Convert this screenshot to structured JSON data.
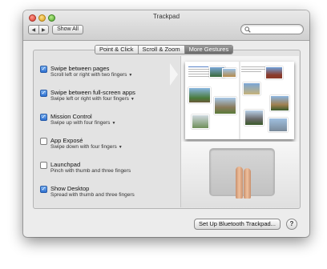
{
  "window": {
    "title": "Trackpad",
    "nav_back": "◀",
    "nav_forward": "▶",
    "show_all": "Show All",
    "search_placeholder": ""
  },
  "tabs": [
    {
      "label": "Point & Click",
      "active": false
    },
    {
      "label": "Scroll & Zoom",
      "active": false
    },
    {
      "label": "More Gestures",
      "active": true
    }
  ],
  "options": [
    {
      "label": "Swipe between pages",
      "sub": "Scroll left or right with two fingers",
      "has_menu": true,
      "checked": true
    },
    {
      "label": "Swipe between full-screen apps",
      "sub": "Swipe left or right with four fingers",
      "has_menu": true,
      "checked": true
    },
    {
      "label": "Mission Control",
      "sub": "Swipe up with four fingers",
      "has_menu": true,
      "checked": true
    },
    {
      "label": "App Exposé",
      "sub": "Swipe down with four fingers",
      "has_menu": true,
      "checked": false
    },
    {
      "label": "Launchpad",
      "sub": "Pinch with thumb and three fingers",
      "has_menu": false,
      "checked": false
    },
    {
      "label": "Show Desktop",
      "sub": "Spread with thumb and three fingers",
      "has_menu": false,
      "checked": true
    }
  ],
  "footer": {
    "bluetooth_button": "Set Up Bluetooth Trackpad...",
    "help_button": "?"
  },
  "colors": {
    "accent": "#2c6fd0",
    "tab_active": "#6a6a6a"
  }
}
